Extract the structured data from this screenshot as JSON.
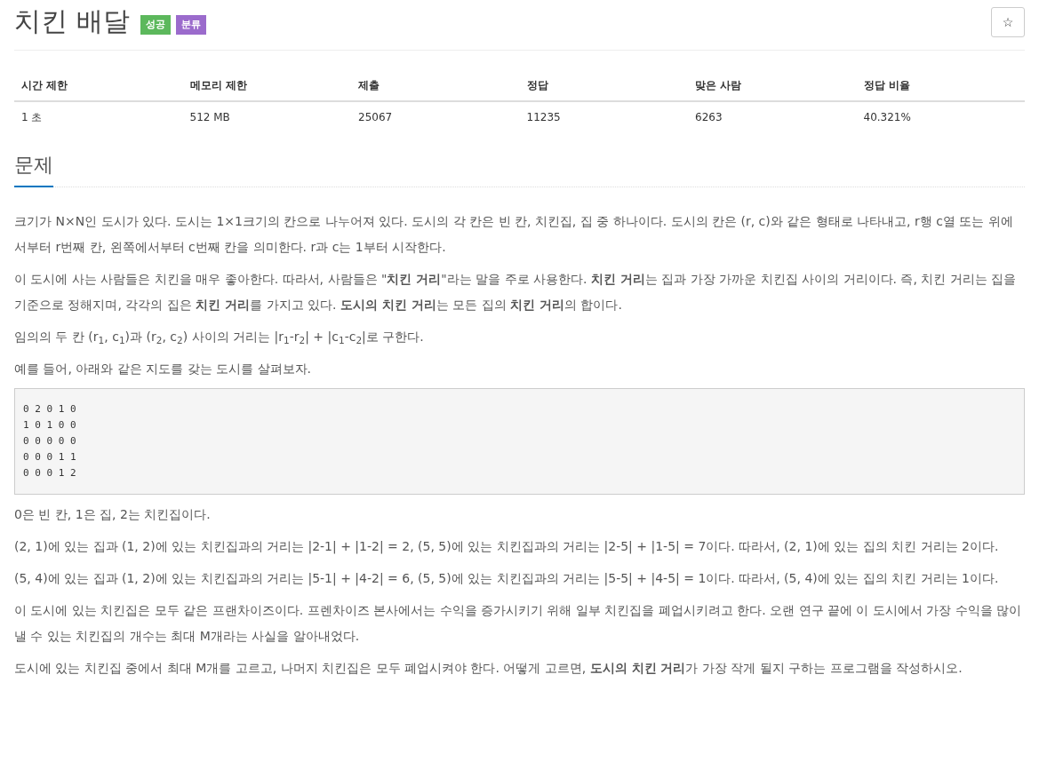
{
  "title": "치킨 배달",
  "badges": [
    {
      "label": "성공",
      "color": "#5cb85c"
    },
    {
      "label": "분류",
      "color": "#9b6bcc"
    }
  ],
  "star_button": "☆",
  "table": {
    "columns": [
      "시간 제한",
      "메모리 제한",
      "제출",
      "정답",
      "맞은 사람",
      "정답 비율"
    ],
    "rows": [
      [
        "1 초",
        "512 MB",
        "25067",
        "11235",
        "6263",
        "40.321%"
      ]
    ]
  },
  "section_title": "문제",
  "blocks": [
    {
      "kind": "text",
      "text": "크기가 N×N인 도시가 있다. 도시는 1×1크기의 칸으로 나누어져 있다. 도시의 각 칸은 빈 칸, 치킨집, 집 중 하나이다. 도시의 칸은 (r, c)와 같은 형태로 나타내고, r행 c열 또는 위에서부터 r번째 칸, 왼쪽에서부터 c번째 칸을 의미한다. r과 c는 1부터 시작한다."
    },
    {
      "kind": "text",
      "text": "이 도시에 사는 사람들은 치킨을 매우 좋아한다. 따라서, 사람들은 \"**치킨 거리**\"라는 말을 주로 사용한다. **치킨 거리**는 집과 가장 가까운 치킨집 사이의 거리이다. 즉, 치킨 거리는 집을 기준으로 정해지며, 각각의 집은 **치킨 거리**를 가지고 있다. **도시의 치킨 거리**는 모든 집의 **치킨 거리**의 합이다."
    },
    {
      "kind": "text",
      "text": "임의의 두 칸 (r$_{1}$, c$_{1}$)과 (r$_{2}$, c$_{2}$) 사이의 거리는 |r$_{1}$-r$_{2}$| + |c$_{1}$-c$_{2}$|로 구한다."
    },
    {
      "kind": "text",
      "text": "예를 들어, 아래와 같은 지도를 갖는 도시를 살펴보자."
    },
    {
      "kind": "code",
      "lines": [
        "0 2 0 1 0",
        "1 0 1 0 0",
        "0 0 0 0 0",
        "0 0 0 1 1",
        "0 0 0 1 2"
      ]
    },
    {
      "kind": "text",
      "text": "0은 빈 칸, 1은 집, 2는 치킨집이다."
    },
    {
      "kind": "text",
      "text": "(2, 1)에 있는 집과 (1, 2)에 있는 치킨집과의 거리는 |2-1| + |1-2| = 2, (5, 5)에 있는 치킨집과의 거리는 |2-5| + |1-5| = 7이다. 따라서, (2, 1)에 있는 집의 치킨 거리는 2이다."
    },
    {
      "kind": "text",
      "text": "(5, 4)에 있는 집과 (1, 2)에 있는 치킨집과의 거리는 |5-1| + |4-2| = 6, (5, 5)에 있는 치킨집과의 거리는 |5-5| + |4-5| = 1이다. 따라서, (5, 4)에 있는 집의 치킨 거리는 1이다."
    },
    {
      "kind": "text",
      "text": "이 도시에 있는 치킨집은 모두 같은 프랜차이즈이다. 프렌차이즈 본사에서는 수익을 증가시키기 위해 일부 치킨집을 폐업시키려고 한다. 오랜 연구 끝에 이 도시에서 가장 수익을 많이 낼 수 있는  치킨집의 개수는 최대 M개라는 사실을 알아내었다."
    },
    {
      "kind": "text",
      "text": "도시에 있는 치킨집 중에서 최대 M개를 고르고, 나머지 치킨집은 모두 폐업시켜야 한다. 어떻게 고르면, **도시의 치킨 거리**가 가장 작게 될지 구하는 프로그램을 작성하시오."
    }
  ]
}
